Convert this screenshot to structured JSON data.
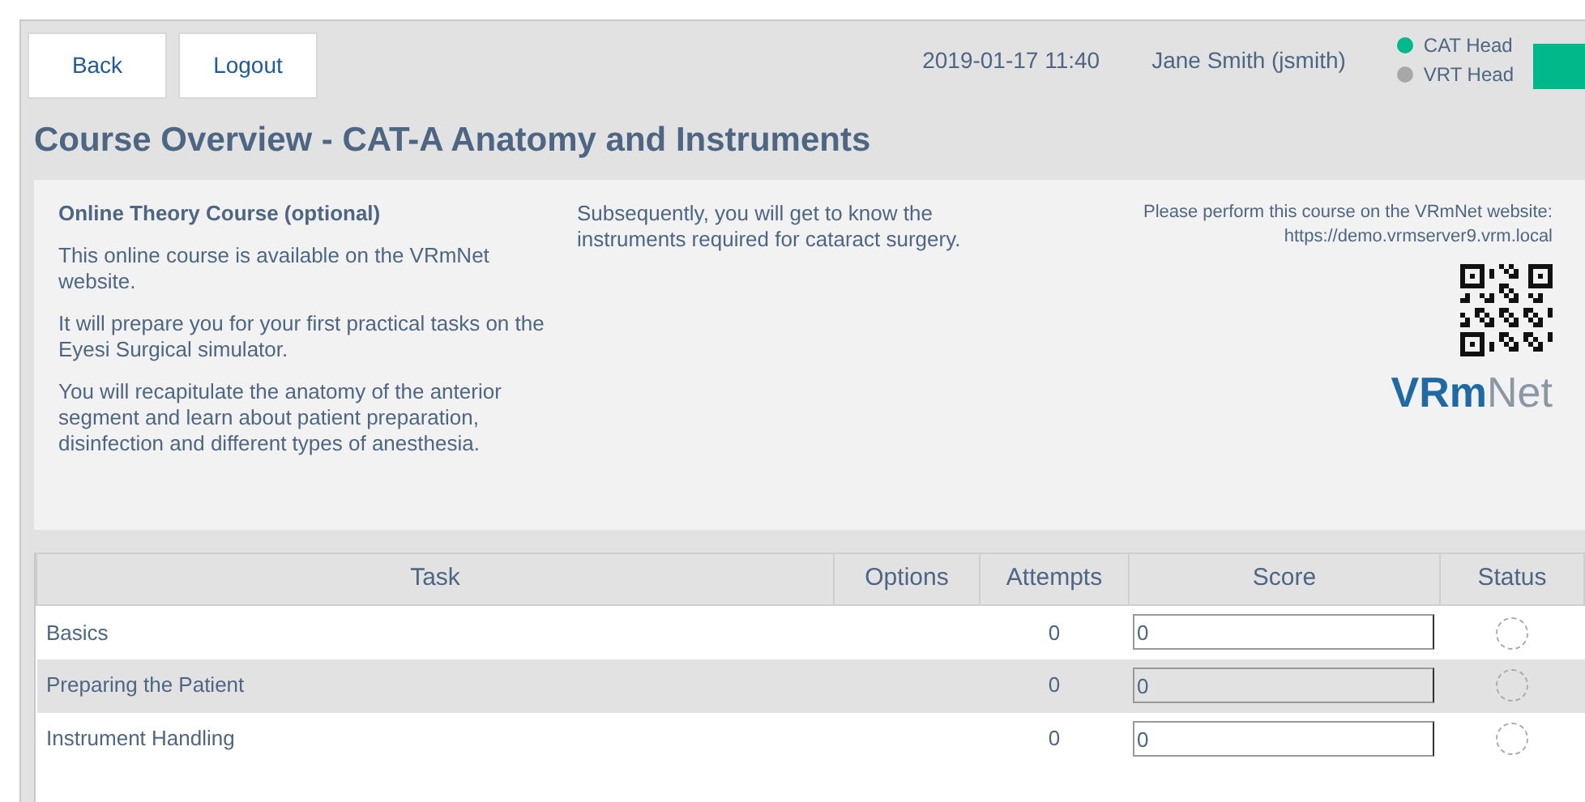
{
  "header": {
    "buttons": [
      "Back",
      "Logout"
    ],
    "datetime": "2019-01-17 11:40",
    "user": "Jane Smith (jsmith)",
    "roles": [
      {
        "label": "CAT Head",
        "active": true
      },
      {
        "label": "VRT Head",
        "active": false
      }
    ]
  },
  "title": "Course Overview - CAT-A Anatomy and Instruments",
  "info": {
    "heading": "Online Theory Course (optional)",
    "paragraphs": [
      "This online course is available on the VRmNet website.",
      "It will prepare you for your first practical tasks on the Eyesi Surgical simulator.",
      "You will recapitulate the anatomy of the anterior segment and learn about patient preparation, disinfection and different types of anesthesia."
    ],
    "middle": "Subsequently, you will get to know the instruments required for cataract surgery.",
    "instruction": "Please perform this course on the VRmNet website:",
    "url": "https://demo.vrmserver9.vrm.local",
    "logo": {
      "bold": "VRm",
      "light": "Net"
    }
  },
  "table": {
    "columns": [
      "Task",
      "Options",
      "Attempts",
      "Score",
      "Status"
    ],
    "rows": [
      {
        "task": "Basics",
        "attempts": "0",
        "score": "0",
        "disabled": false
      },
      {
        "task": "Preparing the Patient",
        "attempts": "0",
        "score": "0",
        "disabled": true
      },
      {
        "task": "Instrument Handling",
        "attempts": "0",
        "score": "0",
        "disabled": false
      }
    ]
  }
}
